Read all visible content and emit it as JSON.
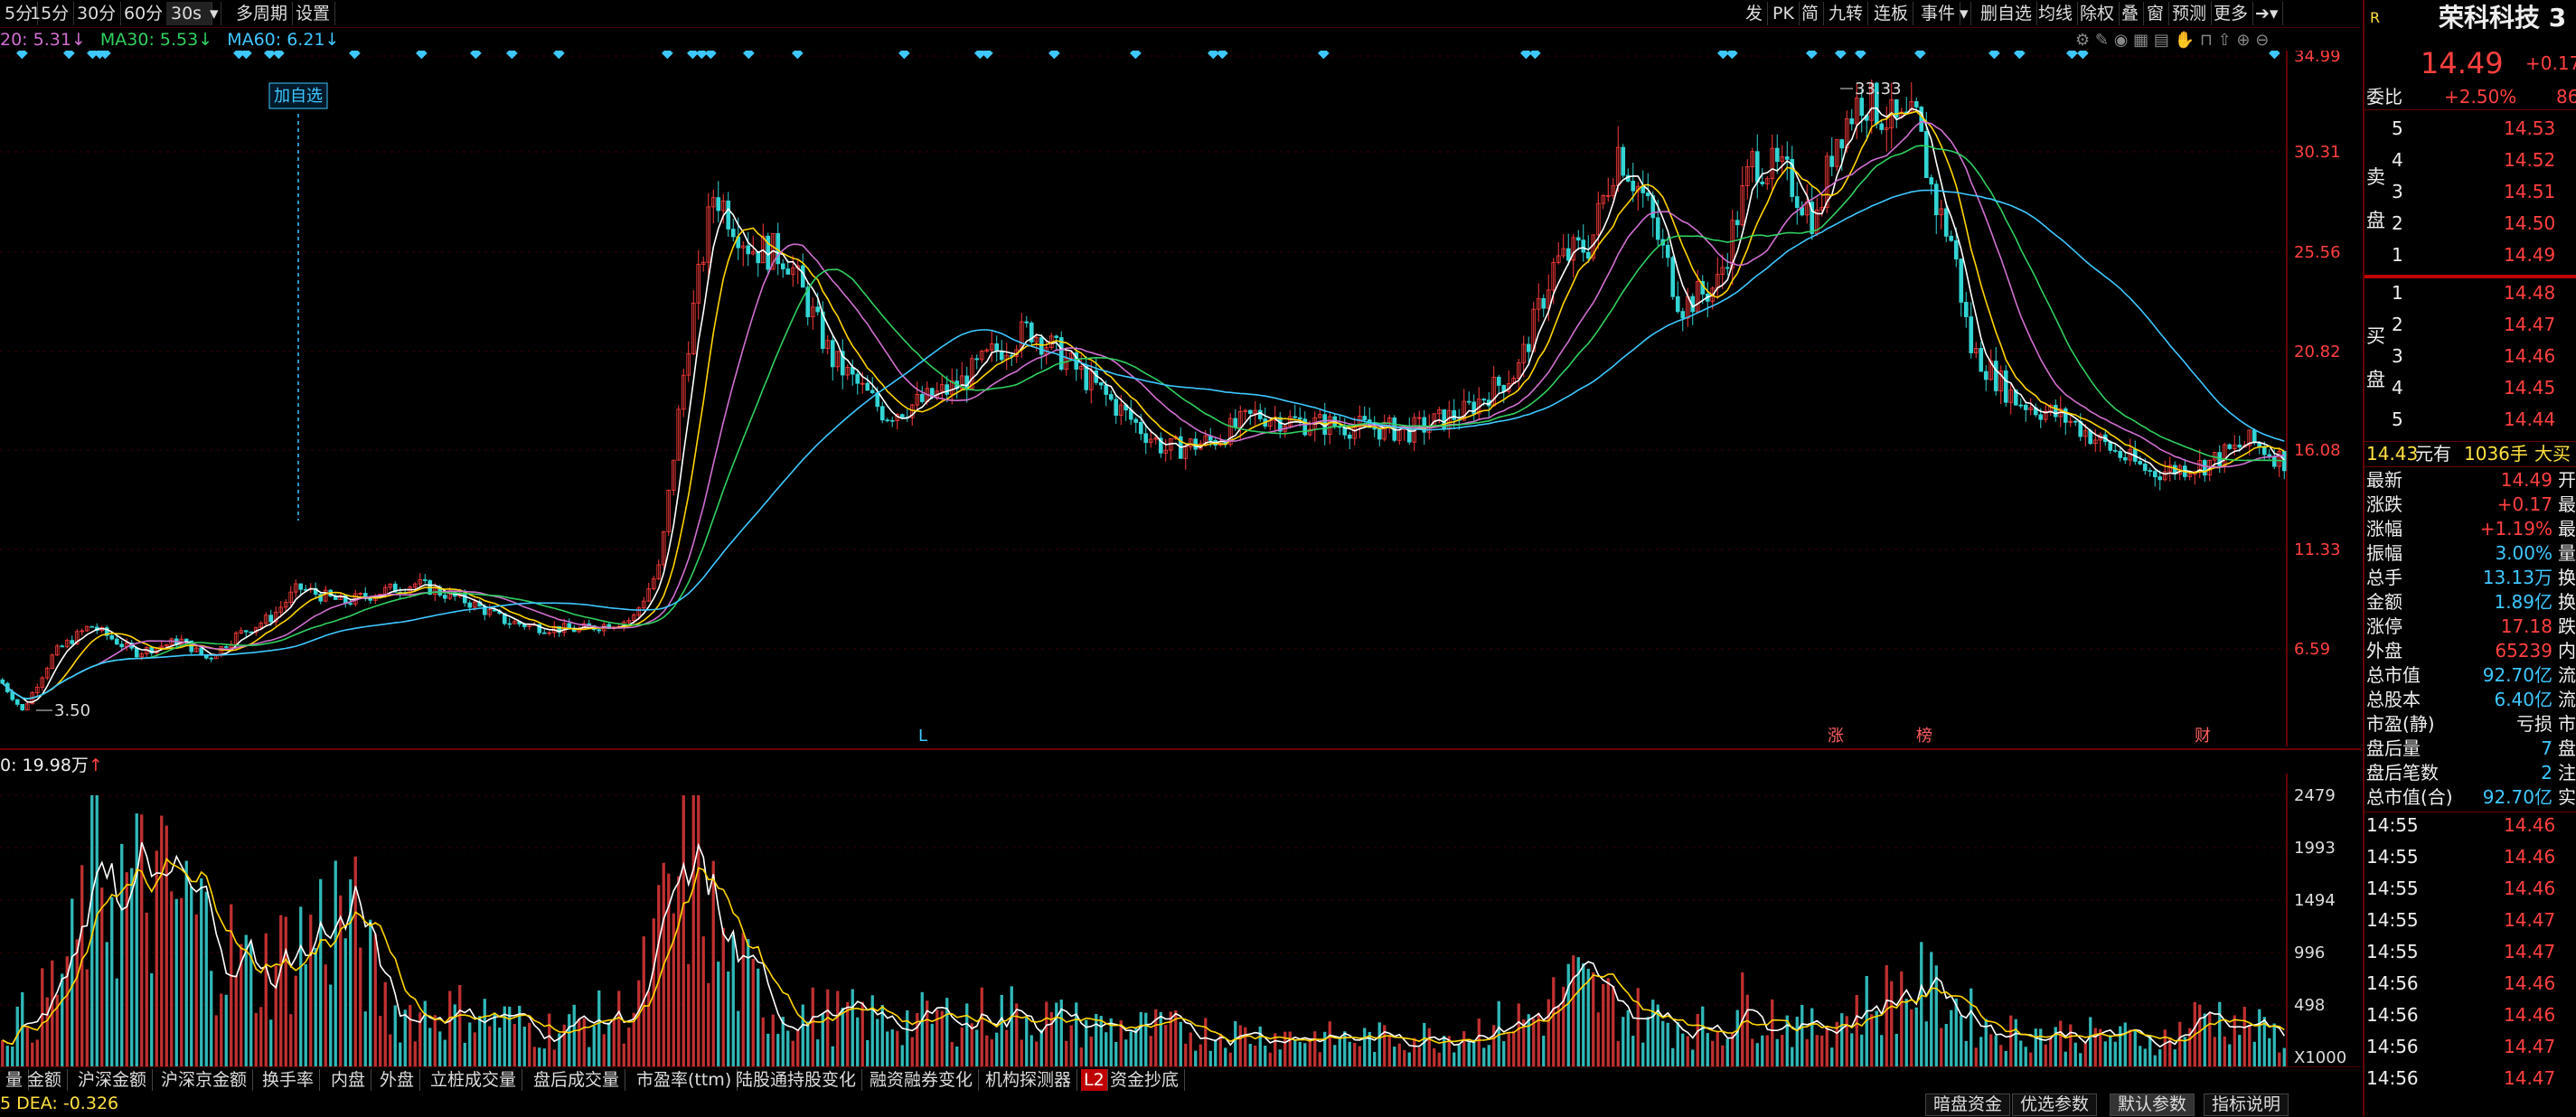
{
  "toolbar": {
    "left": [
      "5分",
      "15分",
      "30分",
      "60分",
      "30s",
      "多周期",
      "设置"
    ],
    "right": [
      "发",
      "PK",
      "简",
      "九转",
      "连板",
      "事件",
      "删自选",
      "均线",
      "除权",
      "叠",
      "窗",
      "预测",
      "更多"
    ]
  },
  "ma_legend": [
    {
      "text": "20: 5.31",
      "arrow": "↓",
      "color": "#d070d0"
    },
    {
      "text": "MA30: 5.53",
      "arrow": "↓",
      "color": "#30d060"
    },
    {
      "text": "MA60: 6.21",
      "arrow": "↓",
      "color": "#3ec8ff"
    }
  ],
  "price_axis": [
    "34.99",
    "30.31",
    "25.56",
    "20.82",
    "16.08",
    "11.33",
    "6.59"
  ],
  "annotations": {
    "high": "33.33",
    "low": "3.50",
    "add_watch": "加自选",
    "markers": [
      "L",
      "涨",
      "榜",
      "财"
    ]
  },
  "volume": {
    "legend": "0: 19.98万",
    "legend_arrow": "↑",
    "axis": [
      "2479",
      "1993",
      "1494",
      "996",
      "498",
      "X1000"
    ]
  },
  "bottom_tabs": [
    "量",
    "金额",
    "沪深金额",
    "沪深京金额",
    "换手率",
    "内盘",
    "外盘",
    "立桩成交量",
    "盘后成交量",
    "市盈率(ttm)",
    "陆股通持股变化",
    "融资融券变化",
    "机构探测器",
    "L2",
    "资金抄底"
  ],
  "status": {
    "dea": "5 DEA: -0.326",
    "buttons": [
      "暗盘资金",
      "优选参数",
      "默认参数",
      "指标说明"
    ]
  },
  "panel": {
    "logo": "R",
    "name": "荣科科技 3",
    "price": "14.49",
    "change": "+0.17",
    "webi_label": "委比",
    "webi_value": "+2.50%",
    "webi_right": "86",
    "sell_label": "卖盘",
    "buy_label": "买盘",
    "asks": [
      {
        "lvl": "5",
        "price": "14.53"
      },
      {
        "lvl": "4",
        "price": "14.52"
      },
      {
        "lvl": "3",
        "price": "14.51"
      },
      {
        "lvl": "2",
        "price": "14.50"
      },
      {
        "lvl": "1",
        "price": "14.49"
      }
    ],
    "bids": [
      {
        "lvl": "1",
        "price": "14.48"
      },
      {
        "lvl": "2",
        "price": "14.47"
      },
      {
        "lvl": "3",
        "price": "14.46"
      },
      {
        "lvl": "4",
        "price": "14.45"
      },
      {
        "lvl": "5",
        "price": "14.44"
      }
    ],
    "big_order": {
      "price": "14.43",
      "mid": "元有",
      "qty": "1036手",
      "right": "大买"
    },
    "stats": [
      {
        "label": "最新",
        "value": "14.49",
        "vc": "red",
        "r": "开"
      },
      {
        "label": "涨跌",
        "value": "+0.17",
        "vc": "red",
        "r": "最"
      },
      {
        "label": "涨幅",
        "value": "+1.19%",
        "vc": "red",
        "r": "最"
      },
      {
        "label": "振幅",
        "value": "3.00%",
        "vc": "cyan",
        "r": "量"
      },
      {
        "label": "总手",
        "value": "13.13万",
        "vc": "cyan",
        "r": "换"
      },
      {
        "label": "金额",
        "value": "1.89亿",
        "vc": "cyan",
        "r": "换"
      },
      {
        "label": "涨停",
        "value": "17.18",
        "vc": "red",
        "r": "跌"
      },
      {
        "label": "外盘",
        "value": "65239",
        "vc": "red",
        "r": "内"
      },
      {
        "label": "总市值",
        "value": "92.70亿",
        "vc": "cyan",
        "r": "流"
      },
      {
        "label": "总股本",
        "value": "6.40亿",
        "vc": "cyan",
        "r": "流"
      },
      {
        "label": "市盈(静)",
        "value": "亏损",
        "vc": "wht",
        "r": "市"
      },
      {
        "label": "盘后量",
        "value": "7",
        "vc": "cyan",
        "r": "盘"
      },
      {
        "label": "盘后笔数",
        "value": "2",
        "vc": "cyan",
        "r": "注"
      },
      {
        "label": "总市值(合)",
        "value": "92.70亿",
        "vc": "cyan",
        "r": "实"
      }
    ],
    "ticks": [
      {
        "time": "14:55",
        "price": "14.46"
      },
      {
        "time": "14:55",
        "price": "14.46"
      },
      {
        "time": "14:55",
        "price": "14.46"
      },
      {
        "time": "14:55",
        "price": "14.47"
      },
      {
        "time": "14:55",
        "price": "14.47"
      },
      {
        "time": "14:56",
        "price": "14.46"
      },
      {
        "time": "14:56",
        "price": "14.46"
      },
      {
        "time": "14:56",
        "price": "14.47"
      },
      {
        "time": "14:56",
        "price": "14.47"
      }
    ]
  },
  "colors": {
    "up": "#ff3c3c",
    "down": "#33d4d4",
    "ma5": "#ffffff",
    "ma10": "#ffd500",
    "ma20": "#d070d0",
    "ma30": "#30d060",
    "ma60": "#3ec8ff"
  }
}
